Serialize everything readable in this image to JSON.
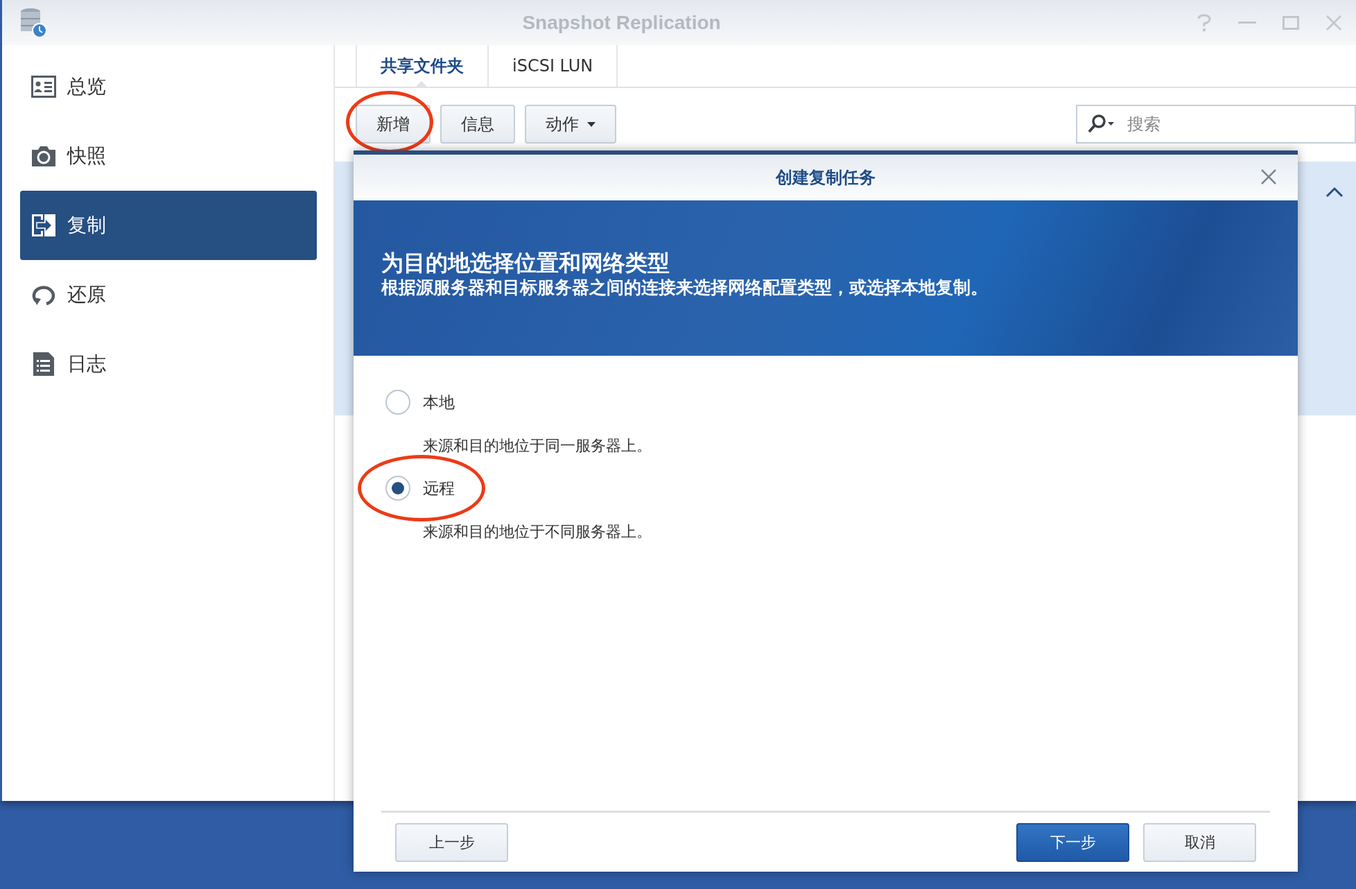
{
  "window": {
    "title": "Snapshot Replication"
  },
  "sidebar": {
    "items": [
      {
        "label": "总览",
        "kind": "overview",
        "selected": false
      },
      {
        "label": "快照",
        "kind": "camera",
        "selected": false
      },
      {
        "label": "复制",
        "kind": "replicate",
        "selected": true
      },
      {
        "label": "还原",
        "kind": "restore",
        "selected": false
      },
      {
        "label": "日志",
        "kind": "log",
        "selected": false
      }
    ]
  },
  "tabs": [
    {
      "label": "共享文件夹",
      "selected": true
    },
    {
      "label": "iSCSI LUN",
      "selected": false
    }
  ],
  "toolbar": {
    "buttons": [
      {
        "label": "新增",
        "kind": "plain",
        "annotated": true
      },
      {
        "label": "信息",
        "kind": "plain",
        "annotated": false
      },
      {
        "label": "动作",
        "kind": "dropdown",
        "annotated": false
      }
    ]
  },
  "search": {
    "placeholder": "搜索"
  },
  "dialog": {
    "title": "创建复制任务",
    "banner": {
      "heading": "为目的地选择位置和网络类型",
      "subheading": "根据源服务器和目标服务器之间的连接来选择网络配置类型，或选择本地复制。"
    },
    "options": [
      {
        "label": "本地",
        "description": "来源和目的地位于同一服务器上。",
        "selected": false,
        "annotated": false
      },
      {
        "label": "远程",
        "description": "来源和目的地位于不同服务器上。",
        "selected": true,
        "annotated": true
      }
    ],
    "buttons": [
      {
        "label": "上一步",
        "kind": "secondary"
      },
      {
        "label": "下一步",
        "kind": "primary"
      },
      {
        "label": "取消",
        "kind": "secondary"
      }
    ]
  }
}
